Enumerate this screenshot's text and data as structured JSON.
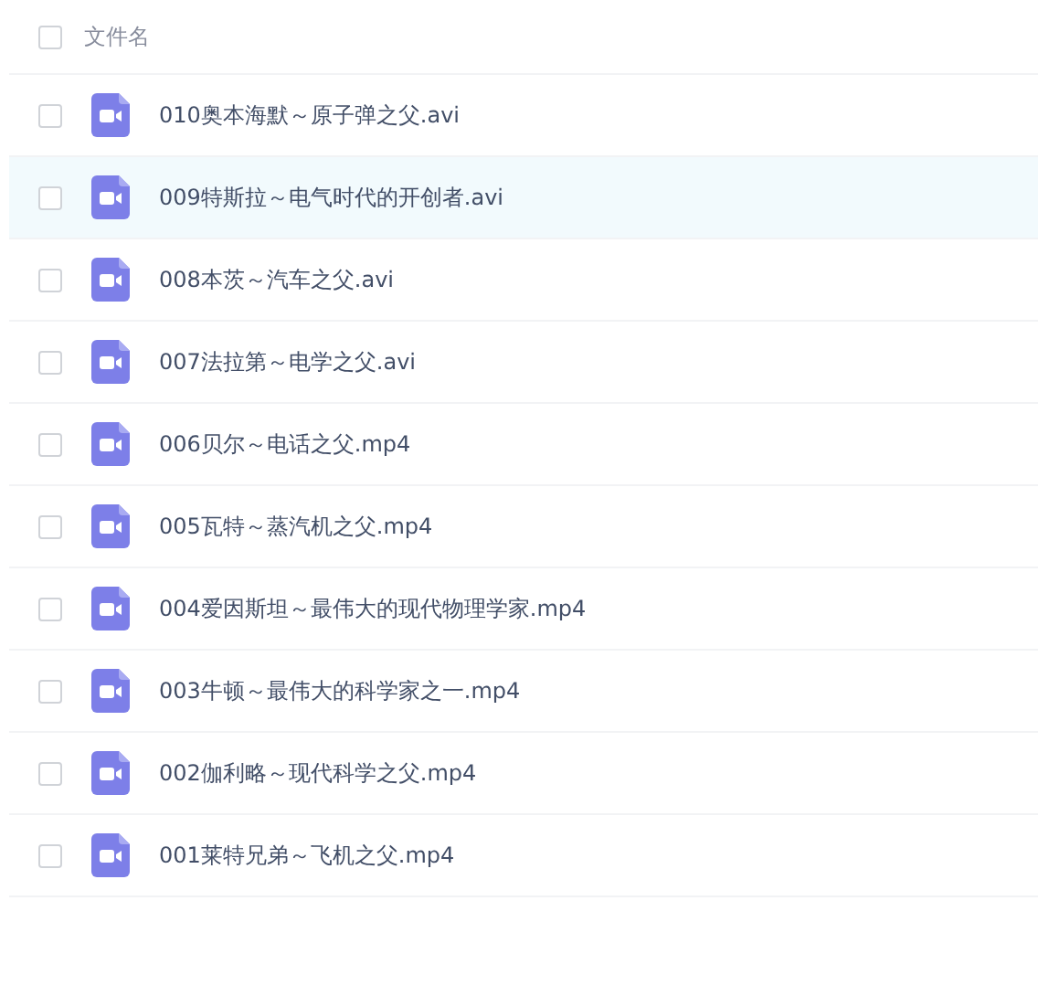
{
  "header": {
    "checked": false,
    "label": "文件名"
  },
  "files": [
    {
      "name": "010奥本海默～原子弹之父.avi",
      "checked": false,
      "highlighted": false
    },
    {
      "name": "009特斯拉～电气时代的开创者.avi",
      "checked": false,
      "highlighted": true
    },
    {
      "name": "008本茨～汽车之父.avi",
      "checked": false,
      "highlighted": false
    },
    {
      "name": "007法拉第～电学之父.avi",
      "checked": false,
      "highlighted": false
    },
    {
      "name": "006贝尔～电话之父.mp4",
      "checked": false,
      "highlighted": false
    },
    {
      "name": "005瓦特～蒸汽机之父.mp4",
      "checked": false,
      "highlighted": false
    },
    {
      "name": "004爱因斯坦～最伟大的现代物理学家.mp4",
      "checked": false,
      "highlighted": false
    },
    {
      "name": "003牛顿～最伟大的科学家之一.mp4",
      "checked": false,
      "highlighted": false
    },
    {
      "name": "002伽利略～现代科学之父.mp4",
      "checked": false,
      "highlighted": false
    },
    {
      "name": "001莱特兄弟～飞机之父.mp4",
      "checked": false,
      "highlighted": false
    }
  ]
}
